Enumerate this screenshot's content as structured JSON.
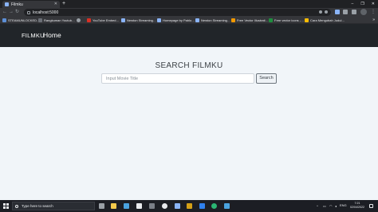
{
  "browser": {
    "tab_title": "Filmku",
    "new_tab_glyph": "+",
    "url": "localhost:5000",
    "window_controls": [
      "–",
      "❐",
      "✕"
    ]
  },
  "bookmarks": [
    {
      "label": "STEAMUNLOCKED…",
      "icon": "steam-icon",
      "color": "#5c8fd6"
    },
    {
      "label": "Rangkuman Youtub…",
      "icon": "play-icon",
      "color": "#6b6f76"
    },
    {
      "label": "",
      "icon": "globe-icon",
      "color": "#9aa0a6"
    },
    {
      "label": "YouTube Embed…",
      "icon": "youtube-icon",
      "color": "#d93025"
    },
    {
      "label": "Newton Streaming…",
      "icon": "bookmark-icon",
      "color": "#8ab4f8"
    },
    {
      "label": "Homepage by Pablo…",
      "icon": "bookmark-icon",
      "color": "#8ab4f8"
    },
    {
      "label": "Newton Streaming…",
      "icon": "bookmark-icon",
      "color": "#8ab4f8"
    },
    {
      "label": "Free Vector Illustrati…",
      "icon": "bookmark-icon",
      "color": "#f29900"
    },
    {
      "label": "Free vector icons -…",
      "icon": "bookmark-icon",
      "color": "#1e8e3e"
    },
    {
      "label": "Cara Mengubah Judul…",
      "icon": "bookmark-icon",
      "color": "#fbbc04"
    }
  ],
  "bookmarks_more": "»",
  "navbar": {
    "brand": "FILMKU",
    "links": [
      "Home"
    ]
  },
  "main": {
    "heading": "SEARCH FILMKU",
    "search_placeholder": "Input Movie Title",
    "search_button": "Search"
  },
  "taskbar": {
    "search_placeholder": "Type here to search",
    "apps": [
      {
        "icon": "task-view-icon",
        "color": "#9aa0a6"
      },
      {
        "icon": "file-explorer-icon",
        "color": "#f2c94c"
      },
      {
        "icon": "store-icon",
        "color": "#4aa3df"
      },
      {
        "icon": "mail-icon",
        "color": "#e8eaed"
      },
      {
        "icon": "calculator-icon",
        "color": "#7a7f87"
      },
      {
        "icon": "chrome-icon",
        "color": "#e8eaed"
      },
      {
        "icon": "notepad-icon",
        "color": "#8ab4f8"
      },
      {
        "icon": "photos-icon",
        "color": "#d4a017"
      },
      {
        "icon": "vscode-icon",
        "color": "#2f80ed"
      },
      {
        "icon": "edge-icon",
        "color": "#2bb673"
      },
      {
        "icon": "settings-icon",
        "color": "#4aa3df"
      }
    ],
    "language": "ENG",
    "time": "7:21",
    "date": "02/04/2022"
  }
}
